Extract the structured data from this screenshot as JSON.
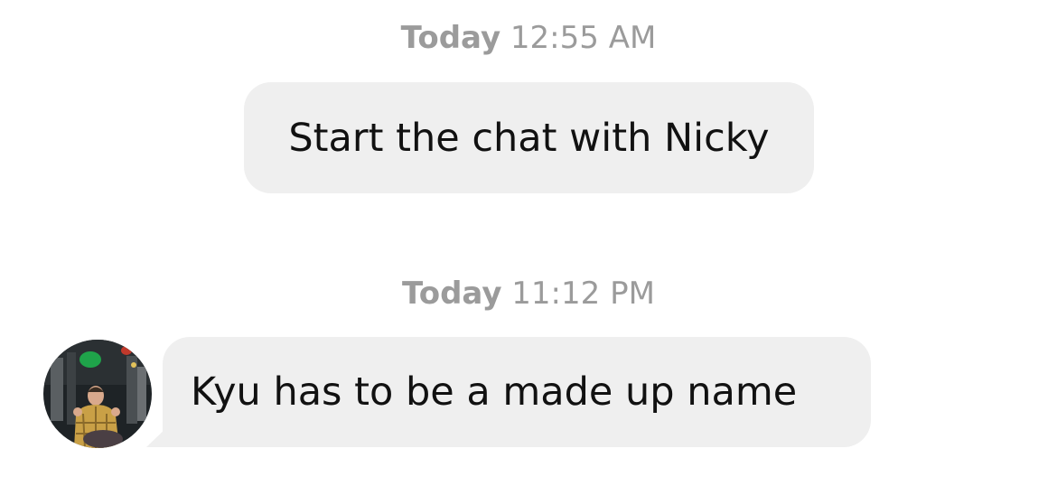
{
  "messages": [
    {
      "timestamp_day": "Today",
      "timestamp_time": "12:55 AM",
      "text": "Start the chat with Nicky"
    },
    {
      "timestamp_day": "Today",
      "timestamp_time": "11:12 PM",
      "text": "Kyu has to be a made up name"
    }
  ],
  "colors": {
    "bubble_bg": "#efefef",
    "timestamp_text": "#9b9b9b",
    "message_text": "#111111"
  }
}
